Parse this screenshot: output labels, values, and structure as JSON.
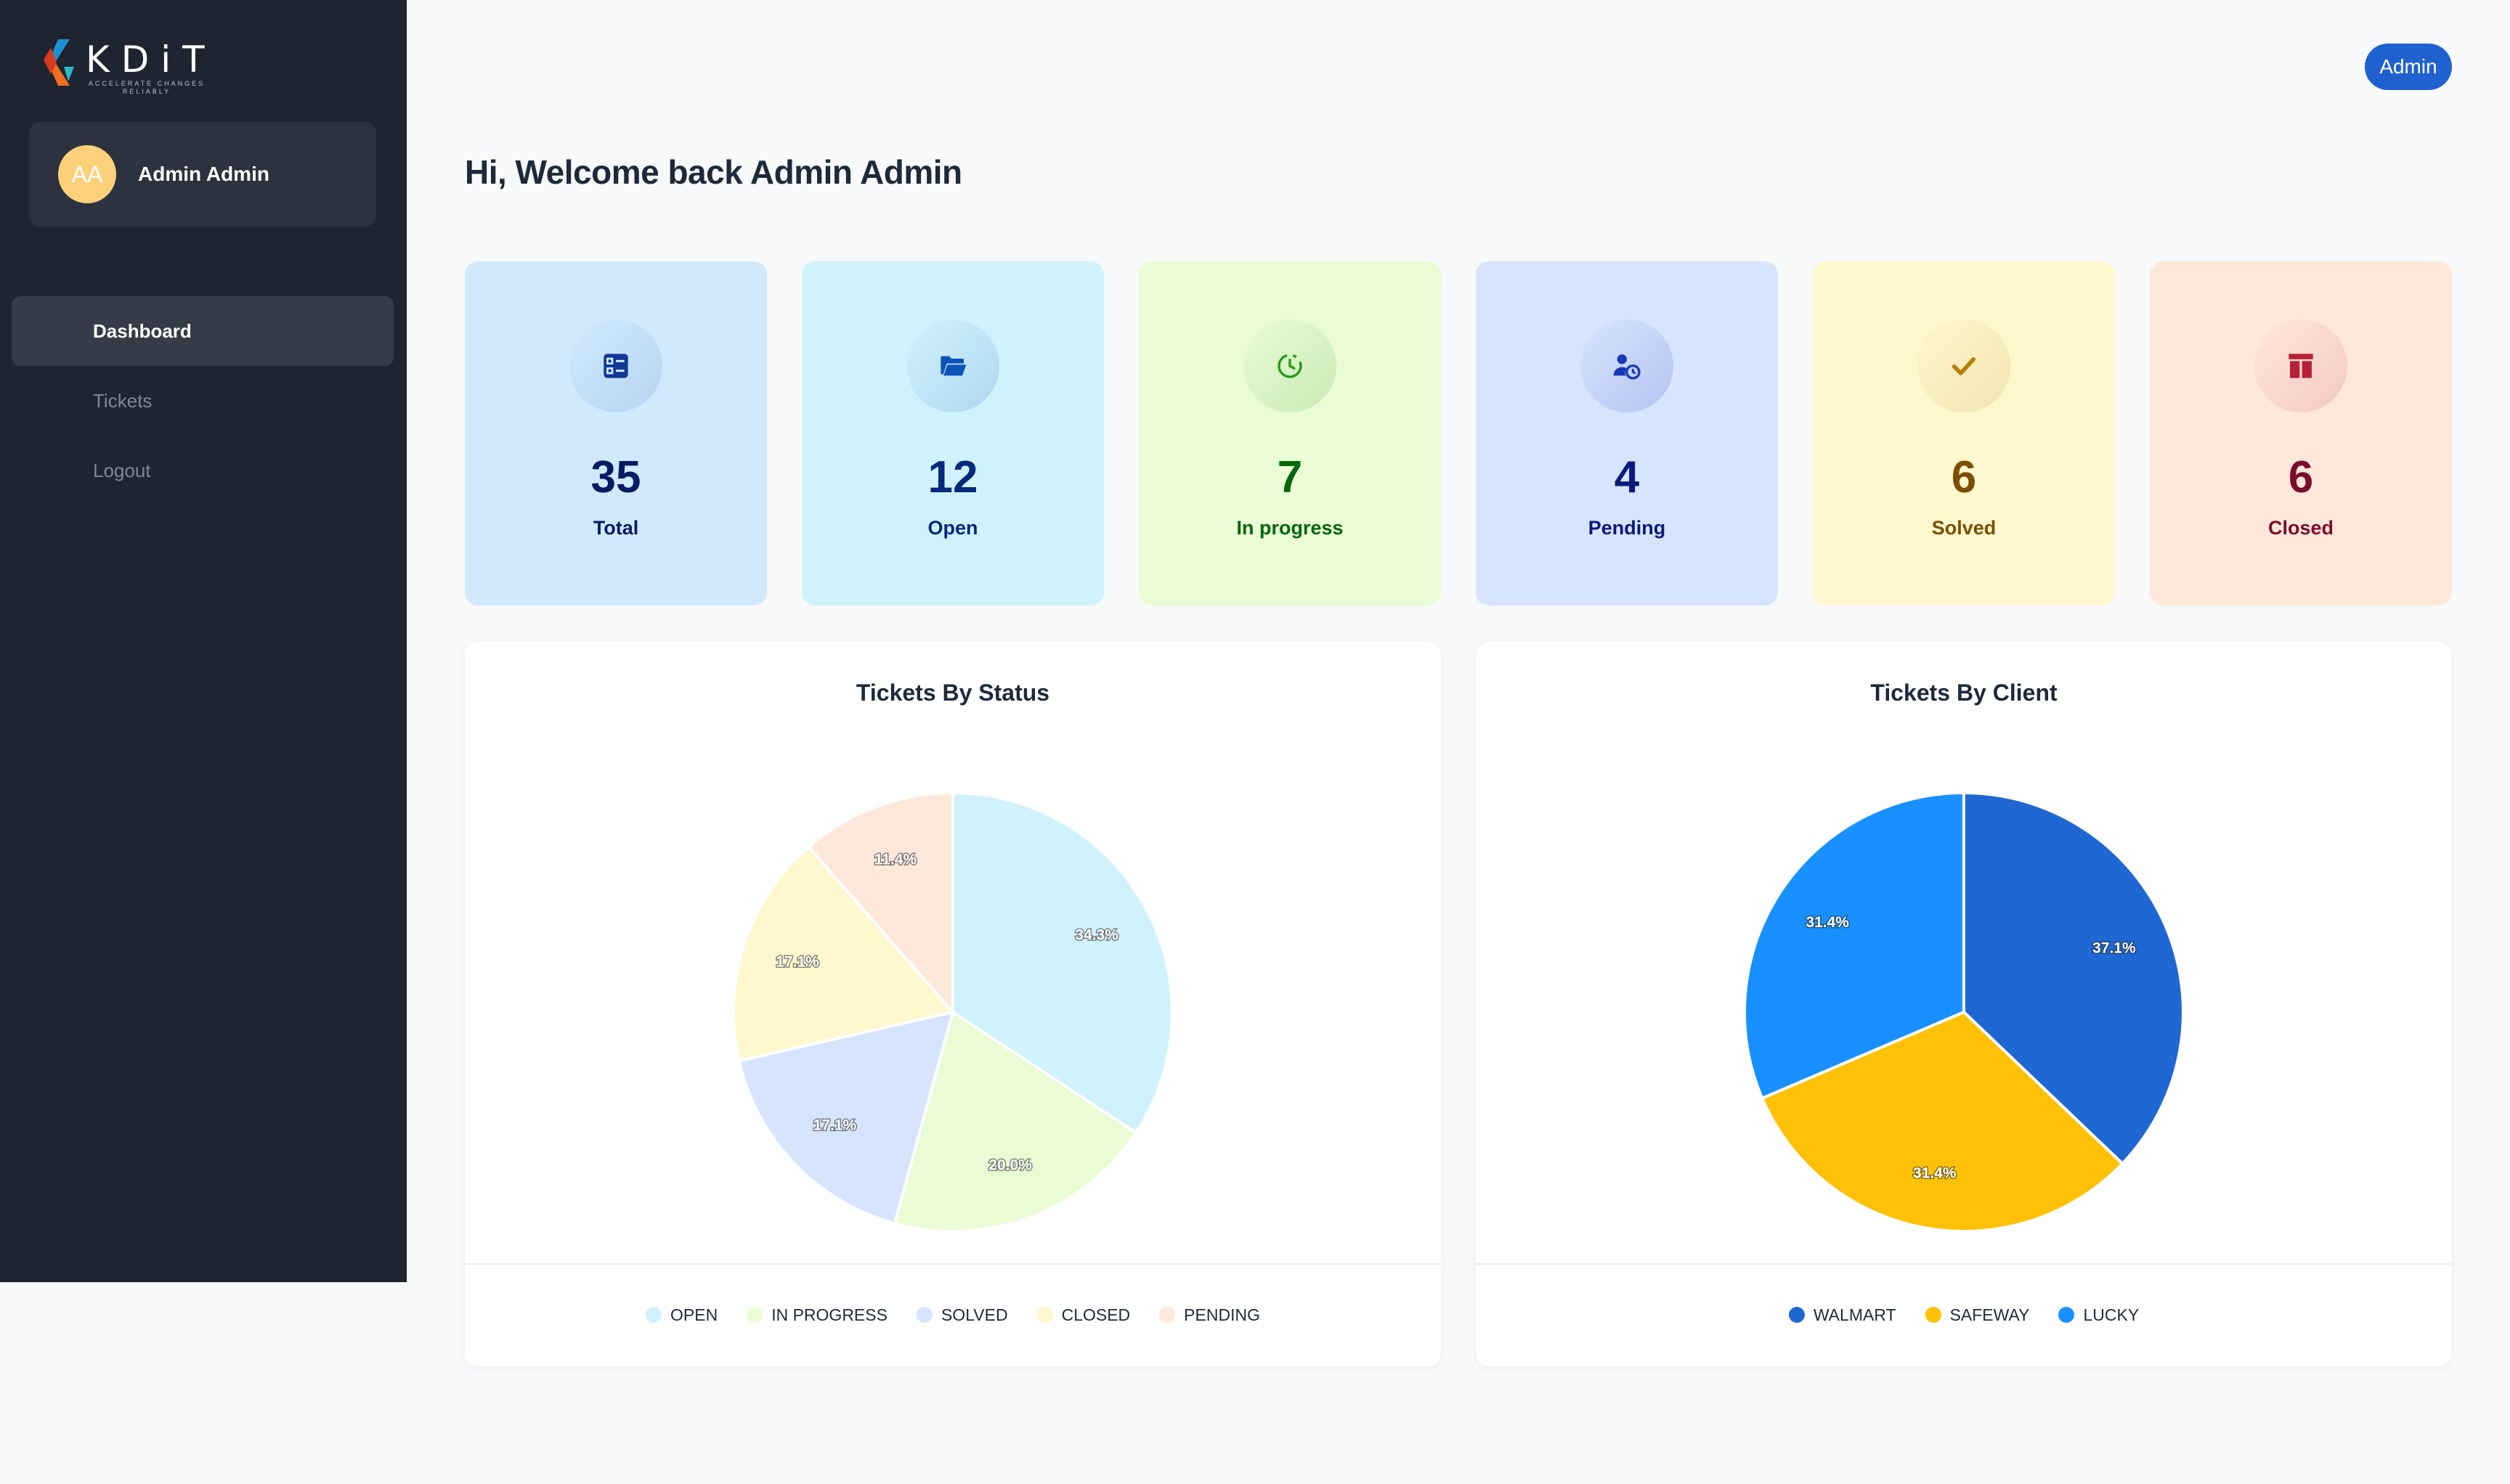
{
  "brand": {
    "name": "KDiT",
    "tagline": "ACCELERATE CHANGES RELIABLY"
  },
  "user": {
    "initials": "AA",
    "name": "Admin Admin"
  },
  "nav": [
    {
      "label": "Dashboard",
      "active": true
    },
    {
      "label": "Tickets",
      "active": false
    },
    {
      "label": "Logout",
      "active": false
    }
  ],
  "header": {
    "role_button": "Admin",
    "welcome": "Hi, Welcome back Admin Admin"
  },
  "stats": [
    {
      "key": "total",
      "value": "35",
      "label": "Total",
      "icon": "list-icon",
      "bg": "#d1e9fc",
      "circle": "#b6d4f2",
      "fg": "#061b64",
      "iconColor": "#103996"
    },
    {
      "key": "open",
      "value": "12",
      "label": "Open",
      "icon": "folder-open-icon",
      "bg": "#d0f2fd",
      "circle": "#aed7ee",
      "fg": "#04297a",
      "iconColor": "#0c53b7"
    },
    {
      "key": "in_progress",
      "value": "7",
      "label": "In progress",
      "icon": "clock-icon",
      "bg": "#e9fcd4",
      "circle": "#c9eab4",
      "fg": "#08660d",
      "iconColor": "#229a16"
    },
    {
      "key": "pending",
      "value": "4",
      "label": "Pending",
      "icon": "user-clock-icon",
      "bg": "#d6e4ff",
      "circle": "#b5c3f0",
      "fg": "#091a7a",
      "iconColor": "#1939b7"
    },
    {
      "key": "solved",
      "value": "6",
      "label": "Solved",
      "icon": "check-icon",
      "bg": "#fff7cd",
      "circle": "#f2e3b0",
      "fg": "#7a4f01",
      "iconColor": "#b78103"
    },
    {
      "key": "closed",
      "value": "6",
      "label": "Closed",
      "icon": "archive-icon",
      "bg": "#ffe7d9",
      "circle": "#f4c9c4",
      "fg": "#7a0c2e",
      "iconColor": "#b72136"
    }
  ],
  "chart_data": [
    {
      "type": "pie",
      "title": "Tickets By Status",
      "categories": [
        "OPEN",
        "IN PROGRESS",
        "SOLVED",
        "CLOSED",
        "PENDING"
      ],
      "values": [
        12,
        7,
        6,
        6,
        4
      ],
      "percent_labels": [
        "34.3%",
        "20.0%",
        "17.1%",
        "17.1%",
        "11.4%"
      ],
      "colors": [
        "#d0f2fd",
        "#e9fcd4",
        "#d6e4ff",
        "#fff7cd",
        "#ffe7d9"
      ],
      "legend_position": "bottom"
    },
    {
      "type": "pie",
      "title": "Tickets By Client",
      "categories": [
        "WALMART",
        "SAFEWAY",
        "LUCKY"
      ],
      "values": [
        13,
        11,
        11
      ],
      "percent_labels": [
        "37.1%",
        "31.4%",
        "31.4%"
      ],
      "colors": [
        "#1f67d2",
        "#ffc107",
        "#1890ff"
      ],
      "legend_position": "bottom"
    }
  ]
}
